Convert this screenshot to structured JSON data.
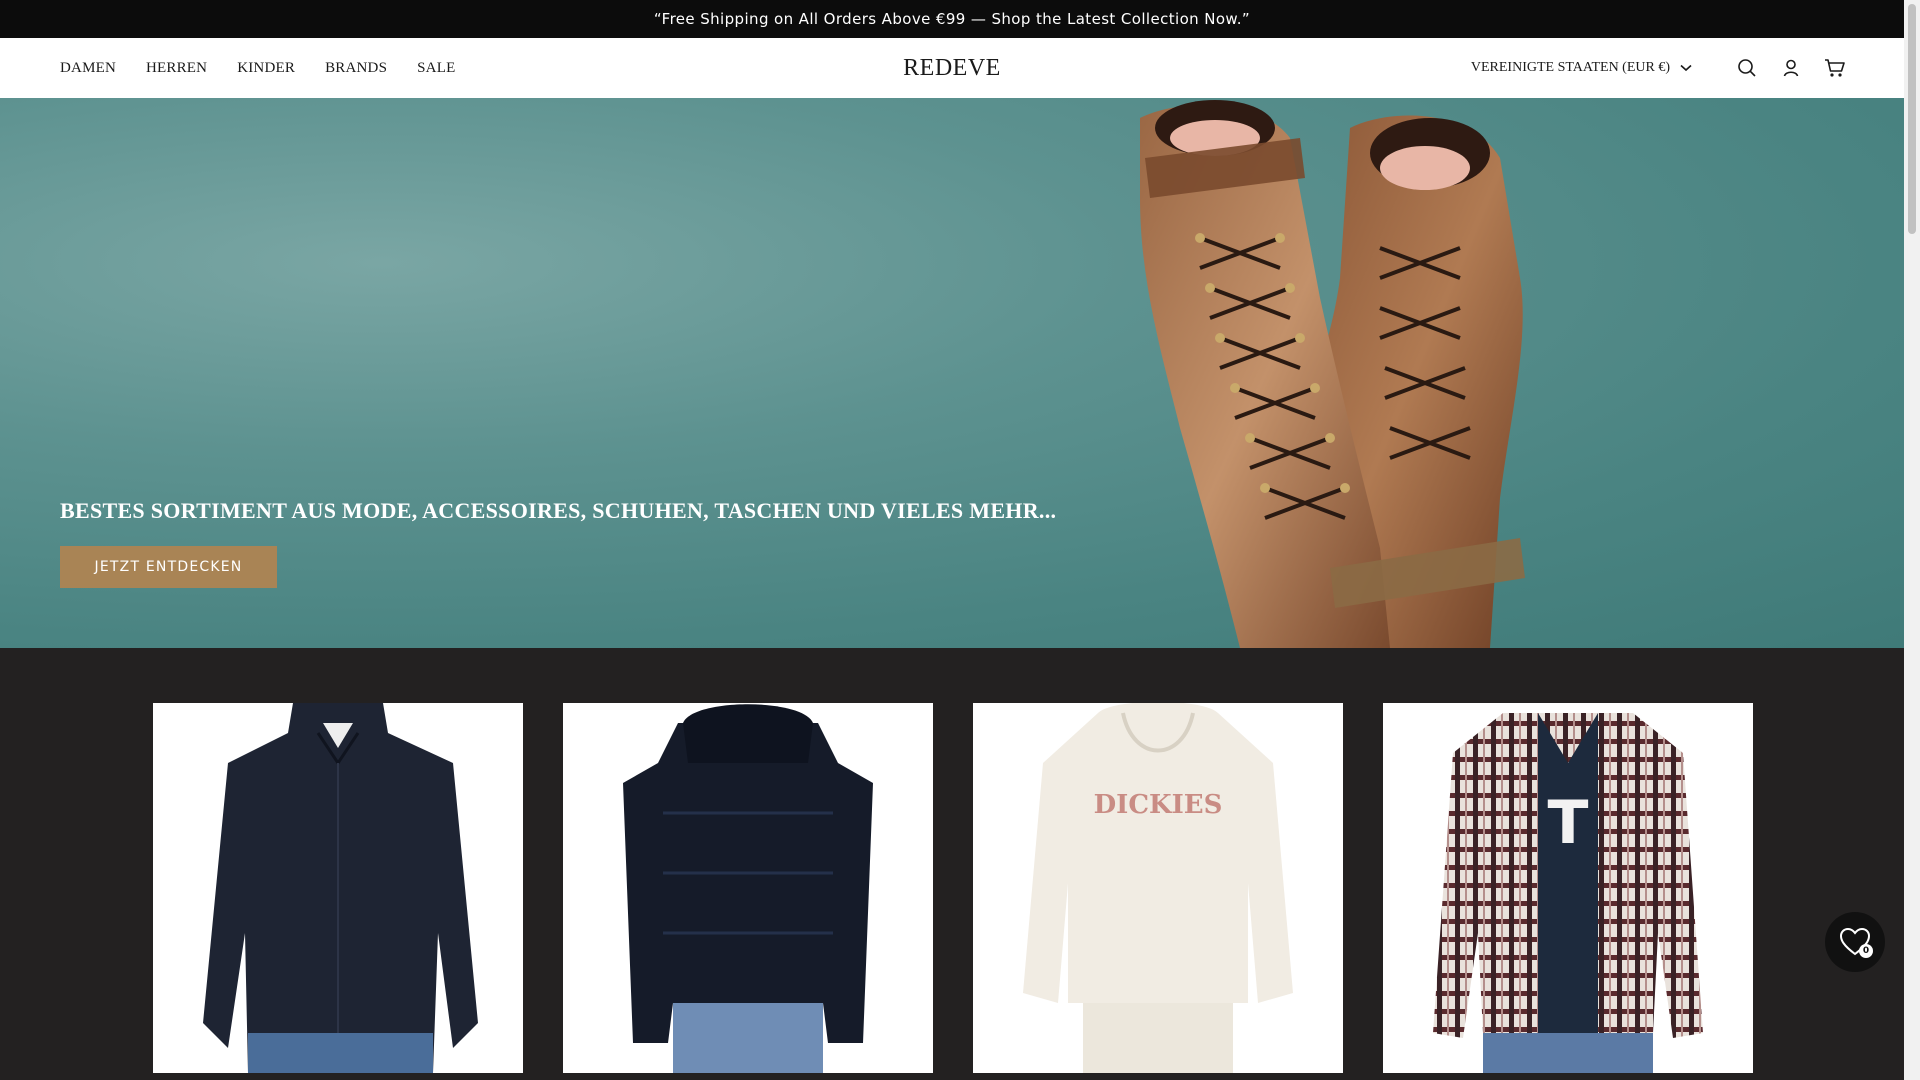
{
  "announcement": {
    "text": "“Free Shipping on All Orders Above €99 — Shop the Latest Collection Now.”"
  },
  "header": {
    "nav": [
      {
        "label": "DAMEN"
      },
      {
        "label": "HERREN"
      },
      {
        "label": "KINDER"
      },
      {
        "label": "BRANDS"
      },
      {
        "label": "SALE"
      }
    ],
    "logo": "REDEVE",
    "country_selector": "VEREINIGTE STAATEN (EUR €)",
    "icons": [
      "search-icon",
      "account-icon",
      "cart-icon"
    ]
  },
  "hero": {
    "title": "BESTES SORTIMENT AUS MODE, ACCESSOIRES, SCHUHEN, TASCHEN UND VIELES MEHR...",
    "button_label": "JETZT ENTDECKEN",
    "background_color": "#5d9290",
    "button_color": "#a98455"
  },
  "products": {
    "items": [
      {
        "name": "product-card-navy-zip-cardigan"
      },
      {
        "name": "product-card-navy-puffer-jacket"
      },
      {
        "name": "product-card-cream-hoodie",
        "print_text": "DICKIES"
      },
      {
        "name": "product-card-plaid-overshirt"
      }
    ]
  },
  "wishlist": {
    "count": "0"
  },
  "colors": {
    "announcement_bg": "#0c0c0c",
    "section_bg": "#232121"
  }
}
